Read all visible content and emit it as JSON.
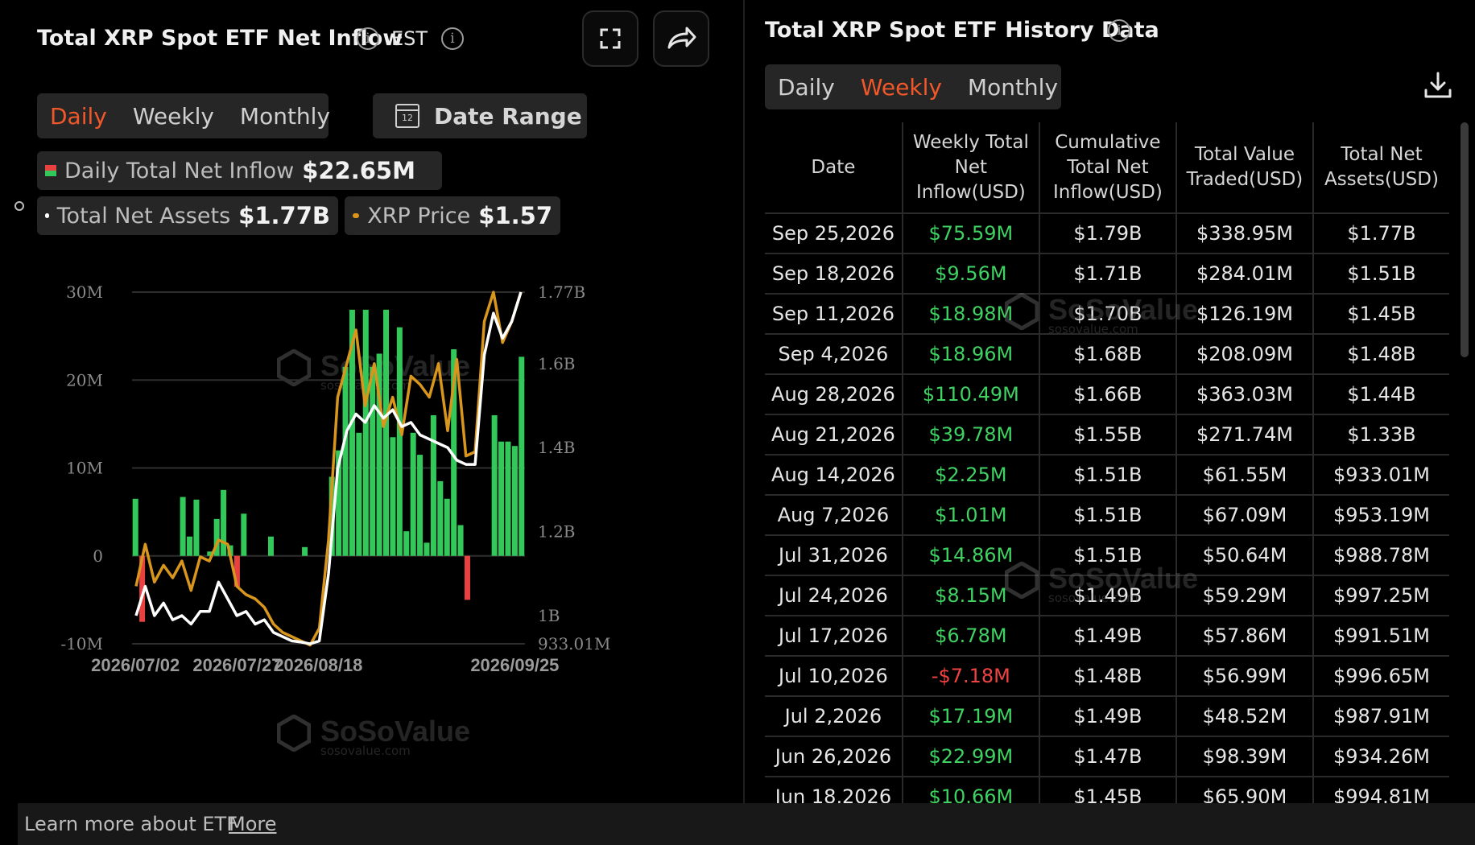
{
  "chart_panel": {
    "title": "Total XRP Spot ETF Net Inflow",
    "timezone": "EST",
    "tabs": [
      {
        "label": "Daily",
        "active": true
      },
      {
        "label": "Weekly",
        "active": false
      },
      {
        "label": "Monthly",
        "active": false
      }
    ],
    "date_range_label": "Date Range",
    "calendar_day": "12",
    "legend": [
      {
        "key": "Daily Total Net Inflow",
        "value": "$22.65M",
        "colors": [
          "#e94040",
          "#33c85a"
        ]
      },
      {
        "key": "Total Net Assets",
        "value": "$1.77B",
        "color": "#ffffff"
      },
      {
        "key": "XRP Price",
        "value": "$1.57",
        "color": "#d8961c"
      }
    ],
    "icons": [
      "fullscreen-icon",
      "share-icon"
    ]
  },
  "watermark": {
    "brand": "SoSoValue",
    "site": "sosovalue.com"
  },
  "chart_data": {
    "type": "bar",
    "left_axis": {
      "ticks": [
        "30M",
        "20M",
        "10M",
        "0",
        "-10M"
      ],
      "range": [
        -10,
        30
      ],
      "unit": "M"
    },
    "right_axis": {
      "ticks": [
        "1.77B",
        "1.6B",
        "1.4B",
        "1.2B",
        "1B",
        "933.01M"
      ],
      "range": [
        0.93301,
        1.77
      ],
      "unit": "B"
    },
    "x_ticks": [
      {
        "label": "2026/07/02",
        "index": 0
      },
      {
        "label": "2026/07/27",
        "index": 9
      },
      {
        "label": "2026/08/18",
        "index": 17
      },
      {
        "label": "2026/09/25",
        "index": 35
      }
    ],
    "colors": {
      "positive": "#33c85a",
      "negative": "#e94040",
      "assets": "#ffffff",
      "price": "#d8961c"
    },
    "series": [
      {
        "name": "Daily Total Net Inflow",
        "kind": "bar",
        "values": [
          6.5,
          -7.5,
          0,
          0,
          0,
          0,
          0,
          6.7,
          2.2,
          6.4,
          0,
          0.5,
          4.2,
          7.5,
          1.2,
          -3.5,
          4.8,
          0,
          0,
          0,
          2.2,
          0,
          0,
          0,
          0,
          1,
          0,
          0,
          0,
          9,
          12,
          21.5,
          28,
          14,
          28,
          21.5,
          23,
          28,
          13.5,
          26,
          2.8,
          14,
          11.5,
          1.5,
          16,
          8.5,
          6.5,
          23.5,
          3.5,
          -5,
          0,
          0,
          0,
          16,
          13,
          13,
          12.5,
          22.65
        ]
      },
      {
        "name": "Total Net Assets",
        "kind": "line",
        "values": [
          1.0,
          1.07,
          1.0,
          1.03,
          0.99,
          1.0,
          0.98,
          1.01,
          1.01,
          1.08,
          1.04,
          1.0,
          1.01,
          0.98,
          0.99,
          0.96,
          0.95,
          0.94,
          0.937,
          0.933,
          0.94,
          1.1,
          1.35,
          1.44,
          1.48,
          1.46,
          1.5,
          1.47,
          1.49,
          1.45,
          1.46,
          1.43,
          1.42,
          1.41,
          1.4,
          1.37,
          1.36,
          1.36,
          1.62,
          1.72,
          1.66,
          1.7,
          1.77
        ]
      },
      {
        "name": "XRP Price",
        "kind": "line",
        "values": [
          1.07,
          1.17,
          1.08,
          1.12,
          1.09,
          1.13,
          1.06,
          1.14,
          1.13,
          1.18,
          1.17,
          1.07,
          1.05,
          1.04,
          1.02,
          0.98,
          0.96,
          0.95,
          0.94,
          0.93,
          0.97,
          1.18,
          1.52,
          1.6,
          1.68,
          1.5,
          1.6,
          1.45,
          1.52,
          1.43,
          1.57,
          1.55,
          1.52,
          1.6,
          1.44,
          1.61,
          1.38,
          1.39,
          1.7,
          1.77,
          1.65,
          1.7,
          1.77
        ]
      }
    ]
  },
  "history_panel": {
    "title": "Total XRP Spot ETF History Data",
    "tabs": [
      {
        "label": "Daily",
        "active": false
      },
      {
        "label": "Weekly",
        "active": true
      },
      {
        "label": "Monthly",
        "active": false
      }
    ],
    "columns": [
      "Date",
      "Weekly Total Net Inflow(USD)",
      "Cumulative Total Net Inflow(USD)",
      "Total Value Traded(USD)",
      "Total Net Assets(USD)"
    ],
    "rows": [
      [
        "Sep 25,2026",
        "$75.59M",
        "$1.79B",
        "$338.95M",
        "$1.77B"
      ],
      [
        "Sep 18,2026",
        "$9.56M",
        "$1.71B",
        "$284.01M",
        "$1.51B"
      ],
      [
        "Sep 11,2026",
        "$18.98M",
        "$1.70B",
        "$126.19M",
        "$1.45B"
      ],
      [
        "Sep 4,2026",
        "$18.96M",
        "$1.68B",
        "$208.09M",
        "$1.48B"
      ],
      [
        "Aug 28,2026",
        "$110.49M",
        "$1.66B",
        "$363.03M",
        "$1.44B"
      ],
      [
        "Aug 21,2026",
        "$39.78M",
        "$1.55B",
        "$271.74M",
        "$1.33B"
      ],
      [
        "Aug 14,2026",
        "$2.25M",
        "$1.51B",
        "$61.55M",
        "$933.01M"
      ],
      [
        "Aug 7,2026",
        "$1.01M",
        "$1.51B",
        "$67.09M",
        "$953.19M"
      ],
      [
        "Jul 31,2026",
        "$14.86M",
        "$1.51B",
        "$50.64M",
        "$988.78M"
      ],
      [
        "Jul 24,2026",
        "$8.15M",
        "$1.49B",
        "$59.29M",
        "$997.25M"
      ],
      [
        "Jul 17,2026",
        "$6.78M",
        "$1.49B",
        "$57.86M",
        "$991.51M"
      ],
      [
        "Jul 10,2026",
        "-$7.18M",
        "$1.48B",
        "$56.99M",
        "$996.65M"
      ],
      [
        "Jul 2,2026",
        "$17.19M",
        "$1.49B",
        "$48.52M",
        "$987.91M"
      ],
      [
        "Jun 26,2026",
        "$22.99M",
        "$1.47B",
        "$98.39M",
        "$934.26M"
      ],
      [
        "Jun 18,2026",
        "$10.66M",
        "$1.45B",
        "$65.90M",
        "$994.81M"
      ]
    ]
  },
  "footer": {
    "text": "Learn more about ETF",
    "link": "More"
  }
}
